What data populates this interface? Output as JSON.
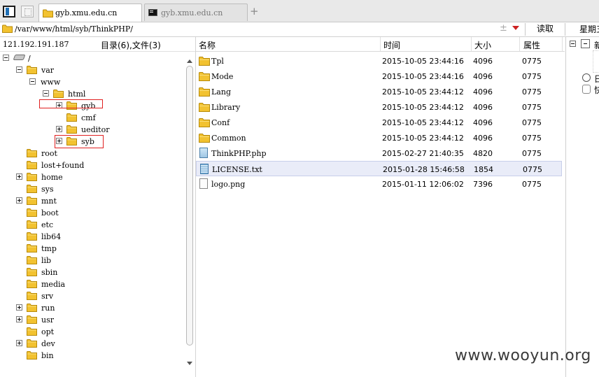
{
  "tabs": [
    {
      "label": "gyb.xmu.edu.cn",
      "active": true,
      "icon": "folder-icon"
    },
    {
      "label": "gyb.xmu.edu.cn",
      "active": false,
      "icon": "terminal-icon"
    }
  ],
  "new_tab_symbol": "+",
  "address": {
    "path": "/var/www/html/syb/ThinkPHP/",
    "separator": "±",
    "read_button": "读取",
    "weekday": "星期五"
  },
  "left_panel": {
    "server_ip": "121.192.191.187",
    "count_label": "目录(6),文件(3)",
    "tree": [
      {
        "label": "/",
        "level": 0,
        "toggle": "minus",
        "icon": "disk"
      },
      {
        "label": "var",
        "level": 1,
        "toggle": "minus"
      },
      {
        "label": "www",
        "level": 2,
        "toggle": "minus",
        "no_icon": true
      },
      {
        "label": "html",
        "level": 3,
        "toggle": "minus"
      },
      {
        "label": "gyb",
        "level": 4,
        "toggle": "plus",
        "highlight": true
      },
      {
        "label": "cmf",
        "level": 4,
        "toggle": "none"
      },
      {
        "label": "ueditor",
        "level": 4,
        "toggle": "plus"
      },
      {
        "label": "syb",
        "level": 4,
        "toggle": "plus",
        "highlight": true
      },
      {
        "label": "root",
        "level": 1,
        "toggle": "none"
      },
      {
        "label": "lost+found",
        "level": 1,
        "toggle": "none"
      },
      {
        "label": "home",
        "level": 1,
        "toggle": "plus"
      },
      {
        "label": "sys",
        "level": 1,
        "toggle": "none"
      },
      {
        "label": "mnt",
        "level": 1,
        "toggle": "plus"
      },
      {
        "label": "boot",
        "level": 1,
        "toggle": "none"
      },
      {
        "label": "etc",
        "level": 1,
        "toggle": "none"
      },
      {
        "label": "lib64",
        "level": 1,
        "toggle": "none"
      },
      {
        "label": "tmp",
        "level": 1,
        "toggle": "none"
      },
      {
        "label": "lib",
        "level": 1,
        "toggle": "none"
      },
      {
        "label": "sbin",
        "level": 1,
        "toggle": "none"
      },
      {
        "label": "media",
        "level": 1,
        "toggle": "none"
      },
      {
        "label": "srv",
        "level": 1,
        "toggle": "none"
      },
      {
        "label": "run",
        "level": 1,
        "toggle": "plus"
      },
      {
        "label": "usr",
        "level": 1,
        "toggle": "plus"
      },
      {
        "label": "opt",
        "level": 1,
        "toggle": "none"
      },
      {
        "label": "dev",
        "level": 1,
        "toggle": "plus"
      },
      {
        "label": "bin",
        "level": 1,
        "toggle": "none"
      }
    ]
  },
  "file_list": {
    "columns": [
      "名称",
      "时间",
      "大小",
      "属性"
    ],
    "rows": [
      {
        "name": "Tpl",
        "time": "2015-10-05 23:44:16",
        "size": "4096",
        "attr": "0775",
        "type": "folder"
      },
      {
        "name": "Mode",
        "time": "2015-10-05 23:44:16",
        "size": "4096",
        "attr": "0775",
        "type": "folder"
      },
      {
        "name": "Lang",
        "time": "2015-10-05 23:44:12",
        "size": "4096",
        "attr": "0775",
        "type": "folder"
      },
      {
        "name": "Library",
        "time": "2015-10-05 23:44:12",
        "size": "4096",
        "attr": "0775",
        "type": "folder"
      },
      {
        "name": "Conf",
        "time": "2015-10-05 23:44:12",
        "size": "4096",
        "attr": "0775",
        "type": "folder"
      },
      {
        "name": "Common",
        "time": "2015-10-05 23:44:12",
        "size": "4096",
        "attr": "0775",
        "type": "folder"
      },
      {
        "name": "ThinkPHP.php",
        "time": "2015-02-27 21:40:35",
        "size": "4820",
        "attr": "0775",
        "type": "php"
      },
      {
        "name": "LICENSE.txt",
        "time": "2015-01-28 15:46:58",
        "size": "1854",
        "attr": "0775",
        "type": "txt",
        "selected": true
      },
      {
        "name": "logo.png",
        "time": "2015-01-11 12:06:02",
        "size": "7396",
        "attr": "0775",
        "type": "png"
      }
    ]
  },
  "right_panel": {
    "items": [
      "新",
      "日",
      "快"
    ]
  },
  "watermark": "www.wooyun.org",
  "colors": {
    "folder": "#f2c230",
    "highlight_box": "#e02020",
    "selected_row": "#e9ecf8"
  }
}
